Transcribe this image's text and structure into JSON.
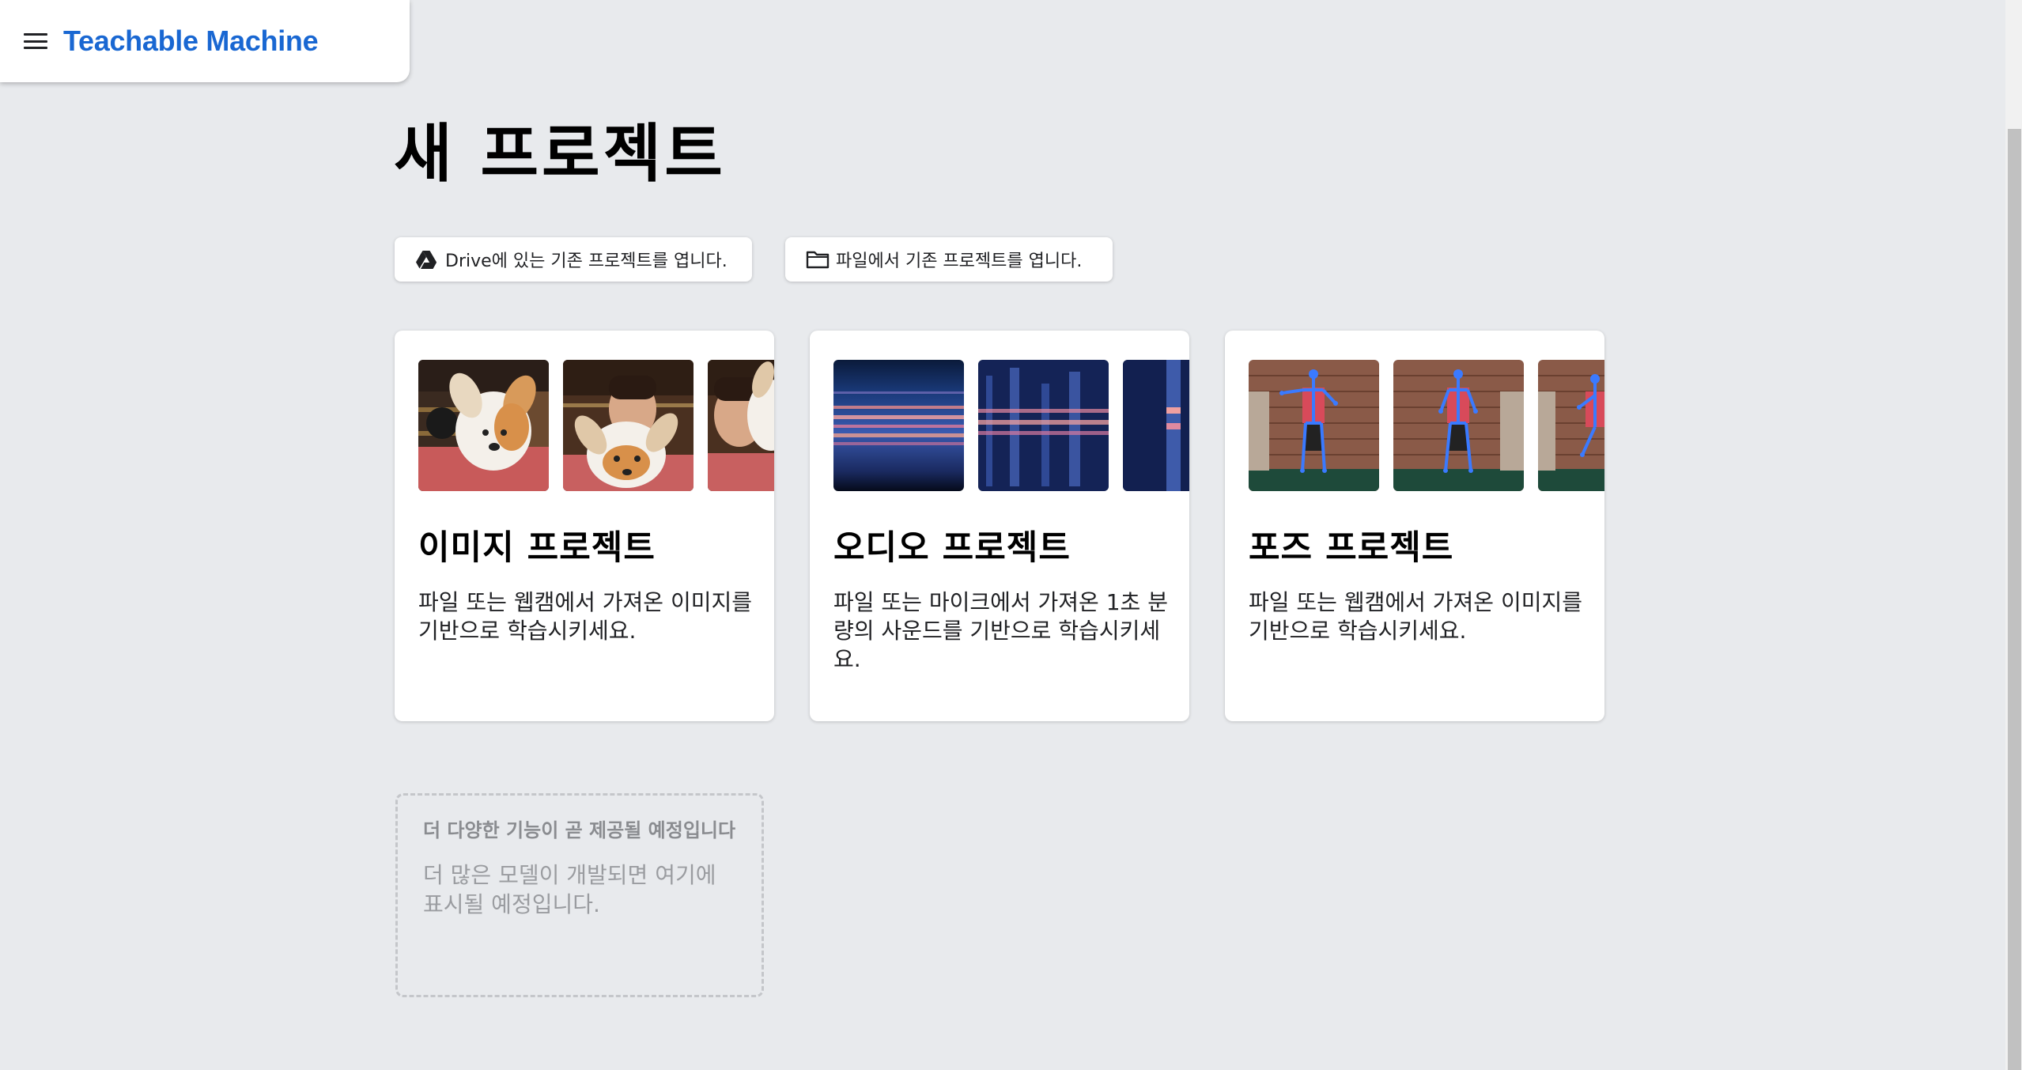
{
  "header": {
    "logo": "Teachable Machine",
    "menu_icon": "hamburger-menu-icon"
  },
  "page_title": "새 프로젝트",
  "open_buttons": {
    "drive": {
      "label": "Drive에 있는 기존 프로젝트를 엽니다.",
      "icon": "google-drive-icon"
    },
    "file": {
      "label": "파일에서 기존 프로젝트를 엽니다.",
      "icon": "folder-icon"
    }
  },
  "cards": {
    "image": {
      "title": "이미지 프로젝트",
      "description": "파일 또는 웹캠에서 가져온 이미지를 기반으로 학습시키세요."
    },
    "audio": {
      "title": "오디오 프로젝트",
      "description": "파일 또는 마이크에서 가져온 1초 분량의 사운드를 기반으로 학습시키세요."
    },
    "pose": {
      "title": "포즈 프로젝트",
      "description": "파일 또는 웹캠에서 가져온 이미지를 기반으로 학습시키세요."
    }
  },
  "coming_soon": {
    "title": "더 다양한 기능이 곧 제공될 예정입니다",
    "description": "더 많은 모델이 개발되면 여기에 표시될 예정입니다."
  },
  "colors": {
    "background": "#e8eaed",
    "brand": "#1967d2",
    "card": "#ffffff"
  }
}
